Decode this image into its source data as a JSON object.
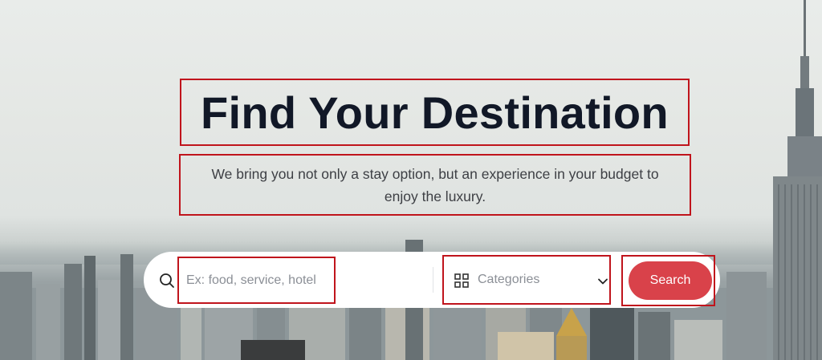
{
  "hero": {
    "title": "Find Your Destination",
    "subtitle": "We bring you not only a stay option, but an experience in your budget to enjoy the luxury."
  },
  "search": {
    "keyword_placeholder": "Ex: food, service, hotel",
    "category_label": "Categories",
    "button_label": "Search"
  },
  "icons": {
    "search": "search-icon",
    "categories": "grid-icon",
    "dropdown": "chevron-down-icon"
  },
  "colors": {
    "title": "#111827",
    "button": "#d9424a",
    "annotation_border": "#c0141c"
  }
}
